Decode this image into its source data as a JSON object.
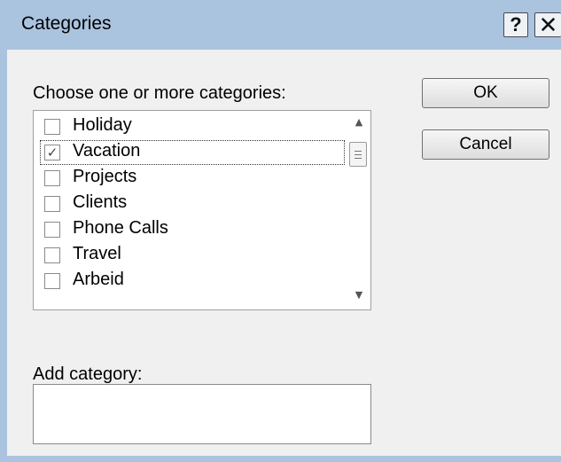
{
  "window": {
    "title": "Categories",
    "help_glyph": "?",
    "close_glyph": "✕"
  },
  "prompt": "Choose one or more categories:",
  "categories": [
    {
      "label": "Holiday",
      "checked": false
    },
    {
      "label": "Vacation",
      "checked": true
    },
    {
      "label": "Projects",
      "checked": false
    },
    {
      "label": "Clients",
      "checked": false
    },
    {
      "label": "Phone Calls",
      "checked": false
    },
    {
      "label": "Travel",
      "checked": false
    },
    {
      "label": "Arbeid",
      "checked": false
    }
  ],
  "focused_item": "Vacation",
  "buttons": {
    "ok": "OK",
    "cancel": "Cancel"
  },
  "add_category": {
    "label": "Add category:",
    "value": ""
  },
  "icons": {
    "scroll_up": "scroll-up-arrow-icon",
    "scroll_down": "scroll-down-arrow-icon",
    "check": "checkmark-icon"
  }
}
